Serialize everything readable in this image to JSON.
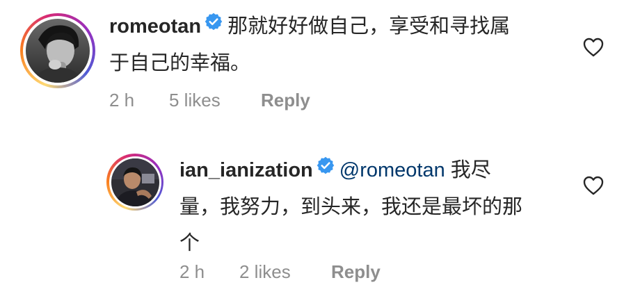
{
  "comments": [
    {
      "username": "romeotan",
      "verified": true,
      "mention": "",
      "text": "那就好好做自己，享受和寻找属于自己的幸福。",
      "line1": "那就好好做自己，享受和寻找属",
      "line2": "于自己的幸福。",
      "time": "2 h",
      "likes": "5 likes",
      "reply_label": "Reply"
    },
    {
      "username": "ian_ianization",
      "verified": true,
      "mention": "@romeotan",
      "text": "我尽量，我努力，到头来，我还是最坏的那个",
      "line1": "我尽",
      "line2": "量，我努力，到头来，我还是最坏的那",
      "line3": "个",
      "time": "2 h",
      "likes": "2 likes",
      "reply_label": "Reply"
    }
  ],
  "colors": {
    "text": "#262626",
    "meta": "#8e8e8e",
    "mention": "#00376b",
    "verified": "#3897f0"
  },
  "icons": {
    "verified": "verified-badge-icon",
    "like": "heart-outline-icon"
  }
}
